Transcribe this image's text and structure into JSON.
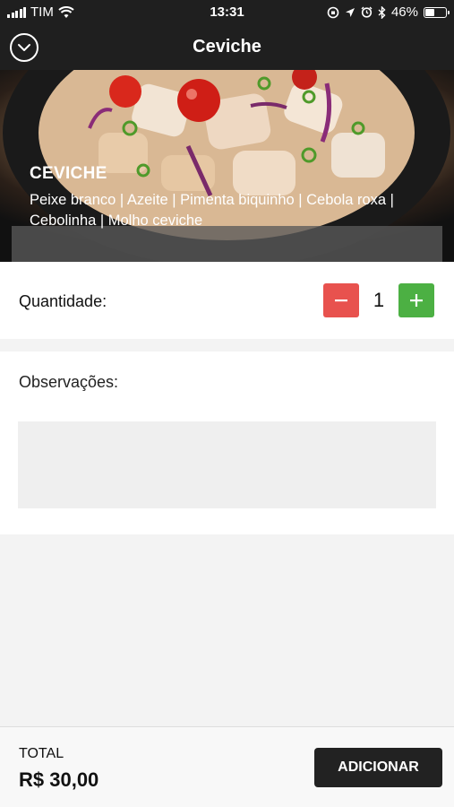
{
  "status_bar": {
    "carrier": "TIM",
    "time": "13:31",
    "battery": "46%",
    "battery_level": 0.46,
    "icons": [
      "signal-icon",
      "wifi-icon",
      "screen-rotation-lock-icon",
      "location-icon",
      "alarm-icon",
      "bluetooth-icon",
      "battery-icon"
    ]
  },
  "nav": {
    "title": "Ceviche",
    "back_icon": "chevron-down-circle-icon"
  },
  "product": {
    "name": "CEVICHE",
    "description": "Peixe branco | Azeite | Pimenta biquinho | Cebola roxa | Cebolinha | Molho ceviche"
  },
  "quantity": {
    "label": "Quantidade:",
    "value": "1",
    "minus_icon": "minus-icon",
    "plus_icon": "plus-icon",
    "minus_color": "#e8524e",
    "plus_color": "#4cb043"
  },
  "notes": {
    "label": "Observações:",
    "value": ""
  },
  "footer": {
    "total_label": "TOTAL",
    "total_value": "R$ 30,00",
    "add_label": "ADICIONAR"
  }
}
